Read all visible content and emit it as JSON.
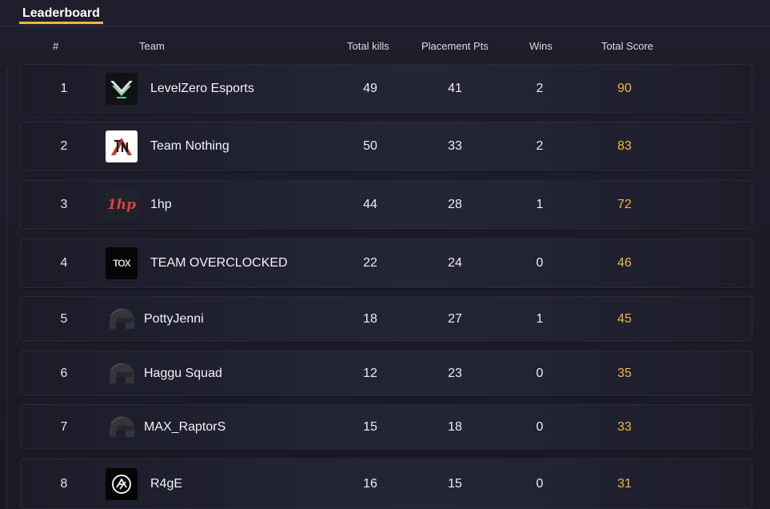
{
  "tabs": {
    "leaderboard_label": "Leaderboard"
  },
  "table": {
    "columns": {
      "rank": "#",
      "team": "Team",
      "total_kills": "Total kills",
      "placement_pts": "Placement Pts",
      "wins": "Wins",
      "total_score": "Total Score"
    },
    "rows": [
      {
        "rank": "1",
        "team": "LevelZero Esports",
        "logo": "levelzero-logo",
        "kills": "49",
        "placement": "41",
        "wins": "2",
        "score": "90"
      },
      {
        "rank": "2",
        "team": "Team Nothing",
        "logo": "team-nothing-logo",
        "kills": "50",
        "placement": "33",
        "wins": "2",
        "score": "83"
      },
      {
        "rank": "3",
        "team": "1hp",
        "logo": "1hp-logo",
        "logo_text": "1hp",
        "kills": "44",
        "placement": "28",
        "wins": "1",
        "score": "72"
      },
      {
        "rank": "4",
        "team": "TEAM OVERCLOCKED",
        "logo": "overclocked-logo",
        "logo_text": "TOX",
        "kills": "22",
        "placement": "24",
        "wins": "0",
        "score": "46"
      },
      {
        "rank": "5",
        "team": "PottyJenni",
        "logo": "helmet-icon",
        "kills": "18",
        "placement": "27",
        "wins": "1",
        "score": "45"
      },
      {
        "rank": "6",
        "team": "Haggu Squad",
        "logo": "helmet-icon",
        "kills": "12",
        "placement": "23",
        "wins": "0",
        "score": "35"
      },
      {
        "rank": "7",
        "team": "MAX_RaptorS",
        "logo": "helmet-icon",
        "kills": "15",
        "placement": "18",
        "wins": "0",
        "score": "33"
      },
      {
        "rank": "8",
        "team": "R4gE",
        "logo": "r4ge-logo",
        "kills": "16",
        "placement": "15",
        "wins": "0",
        "score": "31"
      }
    ]
  },
  "colors": {
    "accent": "#f0b83a",
    "background": "#1b1b28",
    "row_background": "#242638"
  }
}
